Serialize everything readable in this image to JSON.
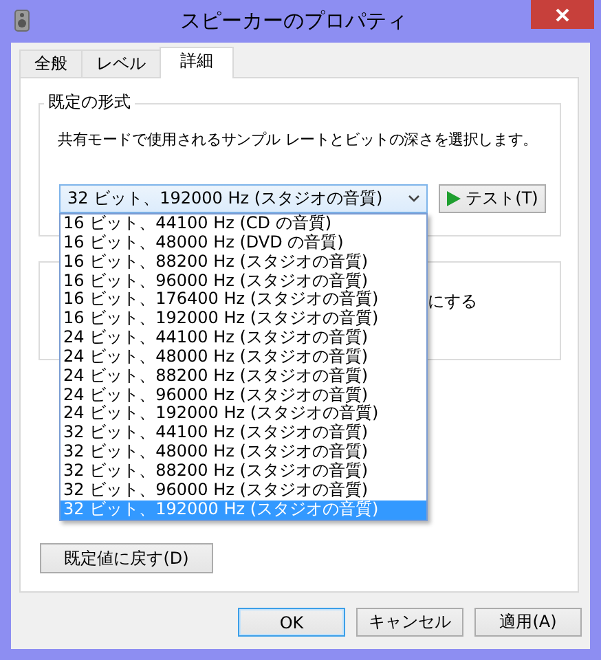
{
  "window": {
    "title": "スピーカーのプロパティ"
  },
  "tabs": [
    {
      "label": "全般",
      "selected": false
    },
    {
      "label": "レベル",
      "selected": false
    },
    {
      "label": "詳細",
      "selected": true
    }
  ],
  "default_format": {
    "title": "既定の形式",
    "description": "共有モードで使用されるサンプル レートとビットの深さを選択します。",
    "format_dropdown": {
      "value": "32 ビット、192000 Hz (スタジオの音質)",
      "expanded": true,
      "options": [
        {
          "label": "16 ビット、44100 Hz (CD の音質)",
          "selected": false
        },
        {
          "label": "16 ビット、48000 Hz (DVD の音質)",
          "selected": false
        },
        {
          "label": "16 ビット、88200 Hz (スタジオの音質)",
          "selected": false
        },
        {
          "label": "16 ビット、96000 Hz (スタジオの音質)",
          "selected": false
        },
        {
          "label": "16 ビット、176400 Hz (スタジオの音質)",
          "selected": false
        },
        {
          "label": "16 ビット、192000 Hz (スタジオの音質)",
          "selected": false
        },
        {
          "label": "24 ビット、44100 Hz (スタジオの音質)",
          "selected": false
        },
        {
          "label": "24 ビット、48000 Hz (スタジオの音質)",
          "selected": false
        },
        {
          "label": "24 ビット、88200 Hz (スタジオの音質)",
          "selected": false
        },
        {
          "label": "24 ビット、96000 Hz (スタジオの音質)",
          "selected": false
        },
        {
          "label": "24 ビット、192000 Hz (スタジオの音質)",
          "selected": false
        },
        {
          "label": "32 ビット、44100 Hz (スタジオの音質)",
          "selected": false
        },
        {
          "label": "32 ビット、48000 Hz (スタジオの音質)",
          "selected": false
        },
        {
          "label": "32 ビット、88200 Hz (スタジオの音質)",
          "selected": false
        },
        {
          "label": "32 ビット、96000 Hz (スタジオの音質)",
          "selected": false
        },
        {
          "label": "32 ビット、192000 Hz (スタジオの音質)",
          "selected": true
        }
      ]
    },
    "test_button": "テスト(T)"
  },
  "second_group": {
    "visible_text": "にする"
  },
  "restore_defaults_button": "既定値に戻す(D)",
  "dialog_buttons": [
    {
      "label": "OK",
      "default": true
    },
    {
      "label": "キャンセル",
      "default": false
    },
    {
      "label": "適用(A)",
      "default": false
    }
  ]
}
